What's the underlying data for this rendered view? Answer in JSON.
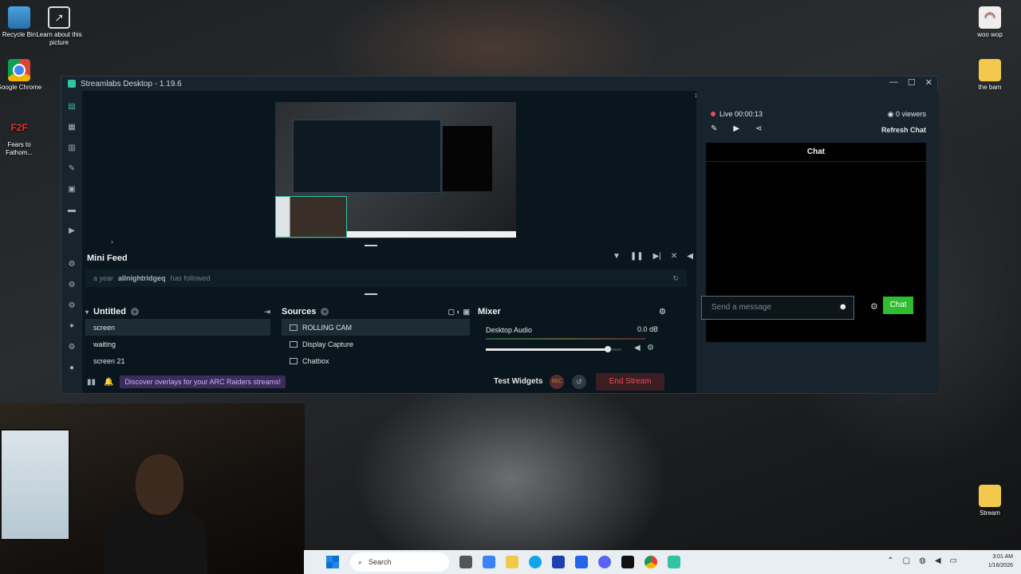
{
  "desktop": {
    "icons_left": [
      {
        "label": "Recycle Bin",
        "icon": "recycle-bin-icon"
      },
      {
        "label": "Learn about this picture",
        "icon": "learn-icon"
      },
      {
        "label": "Google Chrome",
        "icon": "chrome-icon"
      },
      {
        "label": "Fears to Fathom...",
        "icon": "f2f-icon",
        "badge": "F2F"
      }
    ],
    "icons_right": [
      {
        "label": "woo wop",
        "icon": "woo-wop-icon"
      },
      {
        "label": "the bam",
        "icon": "folder-icon"
      },
      {
        "label": "Stream",
        "icon": "folder-icon"
      }
    ]
  },
  "window": {
    "title": "Streamlabs Desktop - 1.19.6",
    "controls": {
      "minimize": "—",
      "maximize": "☐",
      "close": "✕"
    }
  },
  "minifeed": {
    "title": "Mini Feed",
    "event": {
      "time": "a year",
      "user": "allnightridgeq",
      "action": "has followed"
    }
  },
  "scenes": {
    "title": "Untitled",
    "items": [
      "screen",
      "waiting",
      "screen 21"
    ]
  },
  "sources": {
    "title": "Sources",
    "items": [
      "ROLLING CAM",
      "Display Capture",
      "Chatbox"
    ]
  },
  "mixer": {
    "title": "Mixer",
    "channel": {
      "name": "Desktop Audio",
      "level": "0.0 dB"
    },
    "volume_fraction": 0.9
  },
  "statusbar": {
    "promo": "Discover overlays for your ARC Raiders streams!",
    "test_widgets": "Test Widgets",
    "rec_label": "REC",
    "end_stream": "End Stream"
  },
  "live": {
    "status": "Live 00:00:13",
    "viewers": "0 viewers",
    "refresh": "Refresh Chat"
  },
  "chat": {
    "title": "Chat",
    "placeholder": "Send a message",
    "send": "Chat"
  },
  "taskbar": {
    "search": "Search",
    "time": "3:01 AM",
    "date": "1/16/2026"
  },
  "colors": {
    "accent": "#31c3a2",
    "live": "#f24a56",
    "chat_button": "#2ebd2e",
    "promo_bg": "#3c2c5c"
  }
}
